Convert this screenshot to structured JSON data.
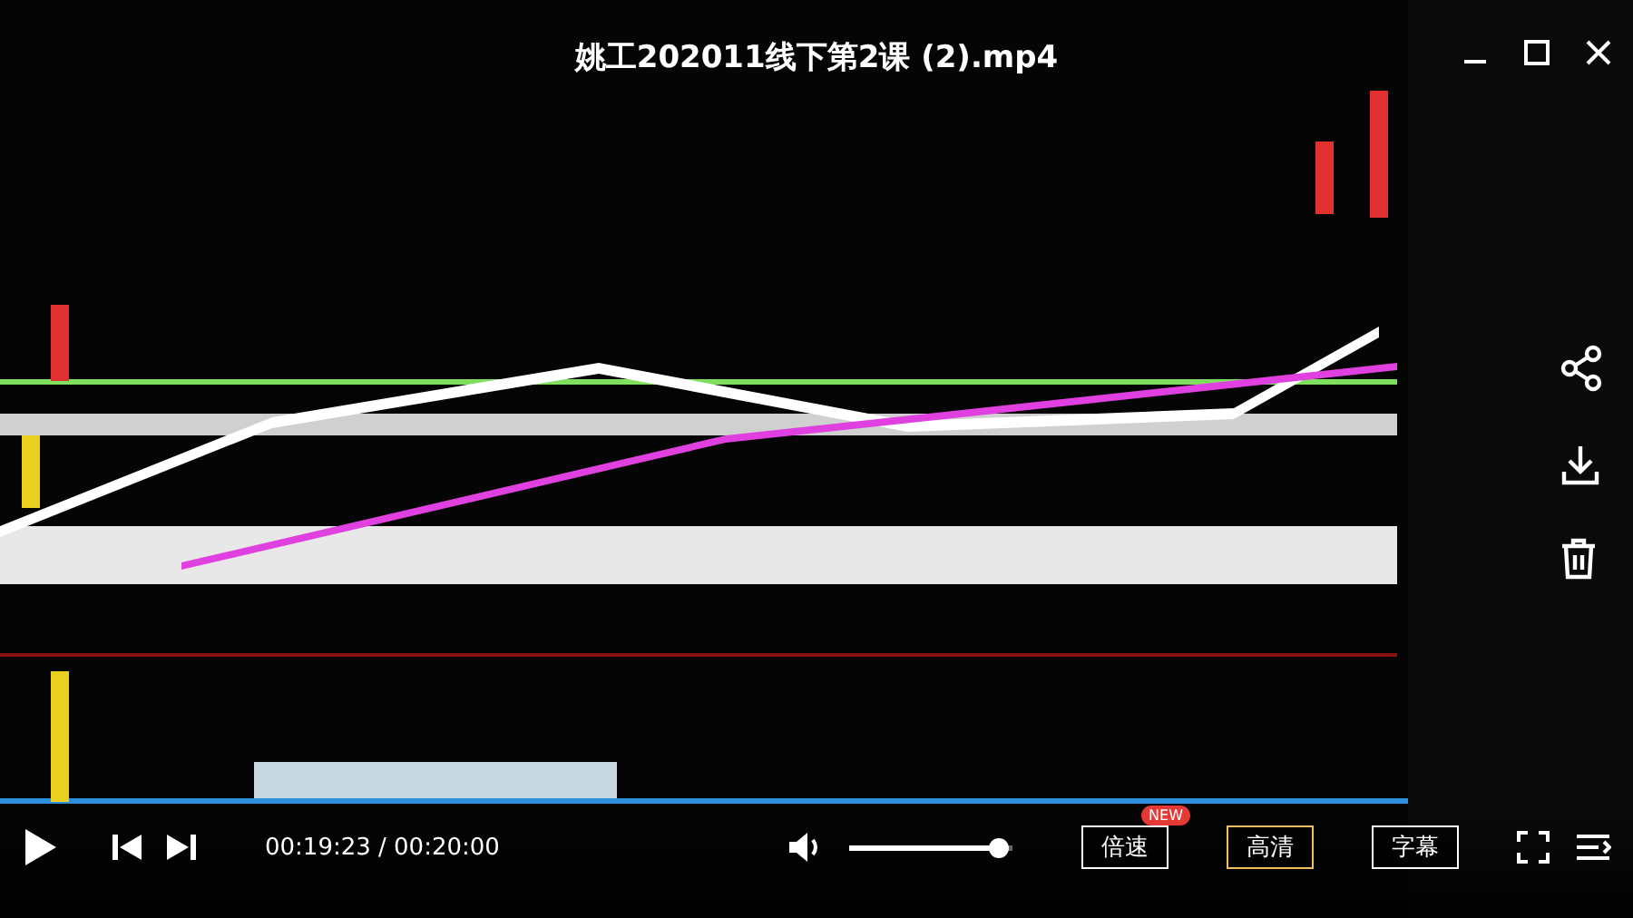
{
  "title": "姚工202011线下第2课 (2).mp4",
  "side_actions": [
    {
      "kind": "share"
    },
    {
      "kind": "download"
    },
    {
      "kind": "delete"
    }
  ],
  "controls": {
    "time": "00:19:23 / 00:20:00",
    "volume": {
      "level": 0.98
    },
    "buttons": [
      {
        "label": "倍速",
        "badge": "NEW",
        "selected": false
      },
      {
        "label": "高清",
        "selected": true
      },
      {
        "label": "字幕",
        "selected": false
      }
    ]
  }
}
